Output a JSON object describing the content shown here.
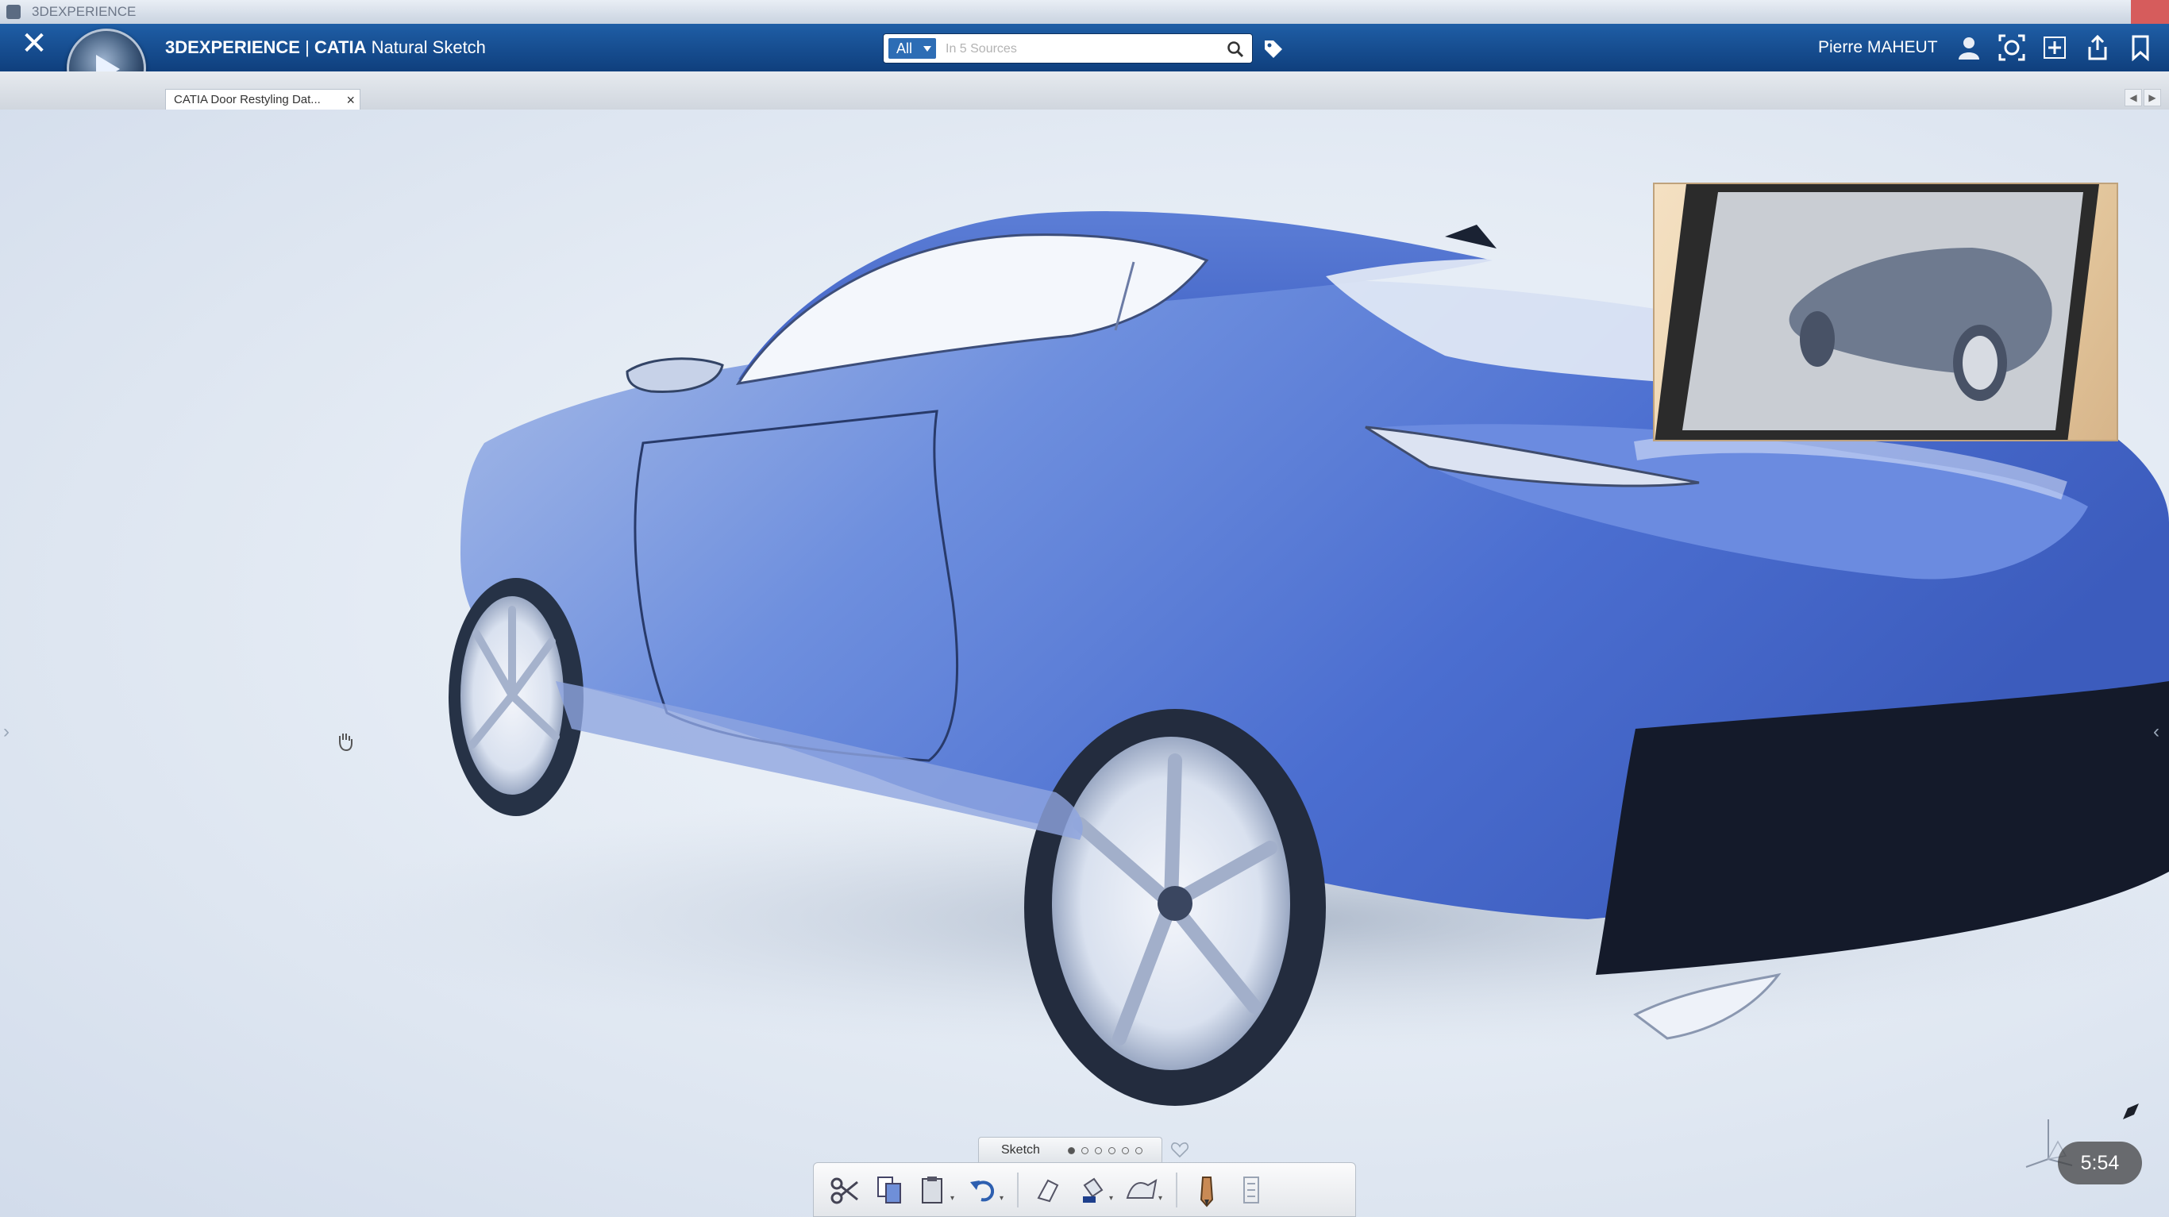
{
  "os_window": {
    "title": "3DEXPERIENCE"
  },
  "header": {
    "brand": "3DEXPERIENCE",
    "separator": " | ",
    "product": "CATIA",
    "app": "Natural Sketch",
    "search": {
      "scope": "All",
      "placeholder": "In 5 Sources"
    },
    "user": "Pierre MAHEUT"
  },
  "tabs": [
    {
      "label": "CATIA Door Restyling Dat..."
    }
  ],
  "sketch_panel": {
    "label": "Sketch",
    "dots_count": 6,
    "active_dot": 0
  },
  "video": {
    "timestamp": "5:54"
  },
  "colors": {
    "topbar": "#1a5396",
    "car_body": "#5b7fd3",
    "accent": "#2d6db5"
  }
}
